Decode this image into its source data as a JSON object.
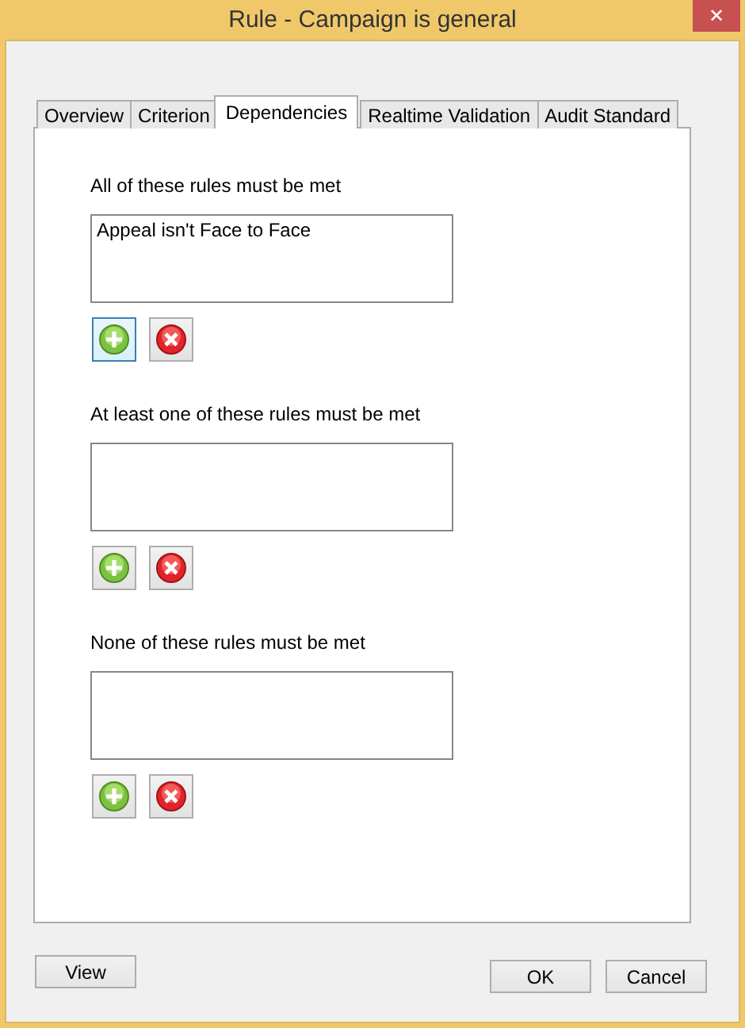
{
  "window": {
    "title": "Rule - Campaign is general",
    "close": "✕"
  },
  "tabs": [
    {
      "label": "Overview",
      "selected": false
    },
    {
      "label": "Criterion",
      "selected": false
    },
    {
      "label": "Dependencies",
      "selected": true
    },
    {
      "label": "Realtime Validation",
      "selected": false
    },
    {
      "label": "Audit Standard",
      "selected": false
    }
  ],
  "sections": [
    {
      "label": "All of these rules must be met",
      "items": [
        "Appeal isn't Face to Face"
      ],
      "add_focused": true
    },
    {
      "label": "At least one of these rules must be met",
      "add_focused": false
    },
    {
      "label": "None of these rules must be met",
      "add_focused": false
    }
  ],
  "buttons": {
    "view": "View",
    "ok": "OK",
    "cancel": "Cancel"
  }
}
